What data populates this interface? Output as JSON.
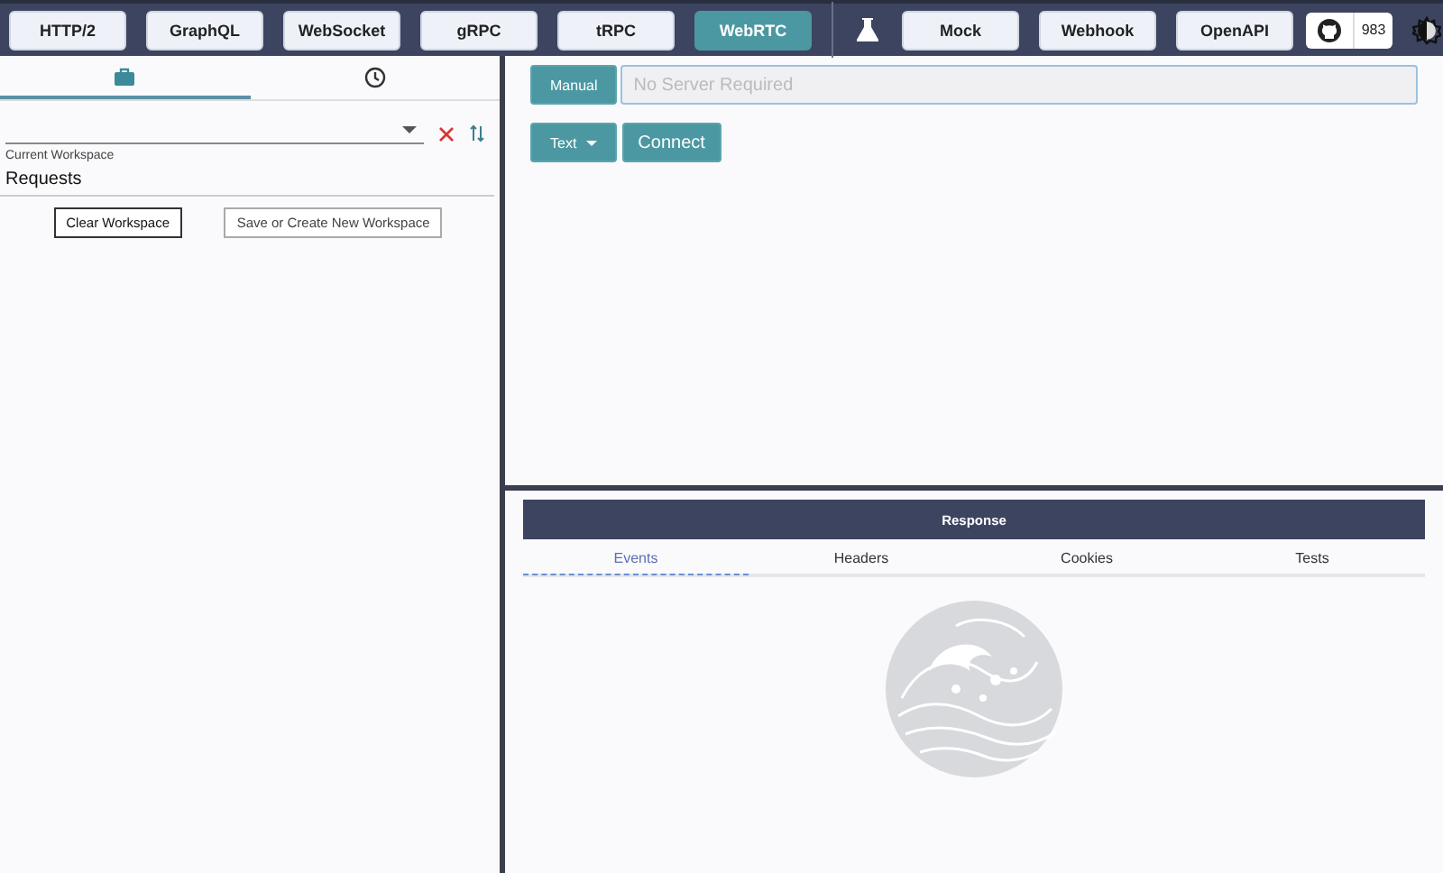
{
  "nav": {
    "protocols": [
      {
        "label": "HTTP/2",
        "selected": false
      },
      {
        "label": "GraphQL",
        "selected": false
      },
      {
        "label": "WebSocket",
        "selected": false
      },
      {
        "label": "gRPC",
        "selected": false
      },
      {
        "label": "tRPC",
        "selected": false
      },
      {
        "label": "WebRTC",
        "selected": true
      }
    ],
    "tools": [
      {
        "label": "Mock",
        "selected": false
      },
      {
        "label": "Webhook",
        "selected": false
      },
      {
        "label": "OpenAPI",
        "selected": false
      }
    ],
    "github_stars": "983"
  },
  "sidebar": {
    "tabs": [
      {
        "kind": "briefcase",
        "selected": true
      },
      {
        "kind": "clock",
        "selected": false
      }
    ],
    "workspace_label": "Current Workspace",
    "requests_heading": "Requests",
    "buttons": [
      "Clear Workspace",
      "Save or Create New Workspace"
    ]
  },
  "request": {
    "mode_button": "Manual",
    "url": {
      "placeholder": "No Server Required"
    },
    "format_button": "Text",
    "connect_button": "Connect"
  },
  "response": {
    "title": "Response",
    "tabs": [
      {
        "label": "Events",
        "selected": true
      },
      {
        "label": "Headers",
        "selected": false
      },
      {
        "label": "Cookies",
        "selected": false
      },
      {
        "label": "Tests",
        "selected": false
      }
    ]
  }
}
